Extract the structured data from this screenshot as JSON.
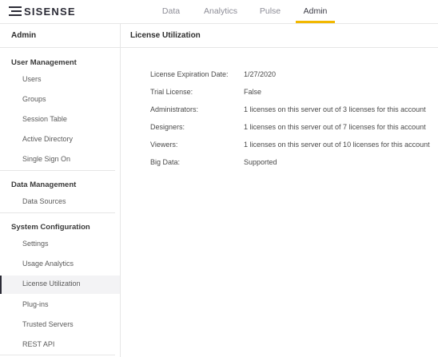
{
  "app": {
    "logo_text": "SISENSE"
  },
  "nav": {
    "tabs": [
      {
        "label": "Data"
      },
      {
        "label": "Analytics"
      },
      {
        "label": "Pulse"
      },
      {
        "label": "Admin"
      }
    ],
    "active_tab": "Admin",
    "accent_color": "#f2b800"
  },
  "sidebar": {
    "header": "Admin",
    "sections": [
      {
        "title": "User Management",
        "items": [
          {
            "label": "Users"
          },
          {
            "label": "Groups"
          },
          {
            "label": "Session Table"
          },
          {
            "label": "Active Directory"
          },
          {
            "label": "Single Sign On"
          }
        ]
      },
      {
        "title": "Data Management",
        "items": [
          {
            "label": "Data Sources"
          }
        ]
      },
      {
        "title": "System Configuration",
        "items": [
          {
            "label": "Settings"
          },
          {
            "label": "Usage Analytics"
          },
          {
            "label": "License Utilization"
          },
          {
            "label": "Plug-ins"
          },
          {
            "label": "Trusted Servers"
          },
          {
            "label": "REST API"
          }
        ]
      }
    ],
    "active_item": "License Utilization"
  },
  "main": {
    "title": "License Utilization",
    "rows": [
      {
        "label": "License Expiration Date:",
        "value": "1/27/2020"
      },
      {
        "label": "Trial License:",
        "value": "False"
      },
      {
        "label": "Administrators:",
        "value": "1 licenses on this server out of 3 licenses for this account"
      },
      {
        "label": "Designers:",
        "value": "1 licenses on this server out of 7 licenses for this account"
      },
      {
        "label": "Viewers:",
        "value": "1 licenses on this server out of 10 licenses for this account"
      },
      {
        "label": "Big Data:",
        "value": "Supported"
      }
    ]
  }
}
